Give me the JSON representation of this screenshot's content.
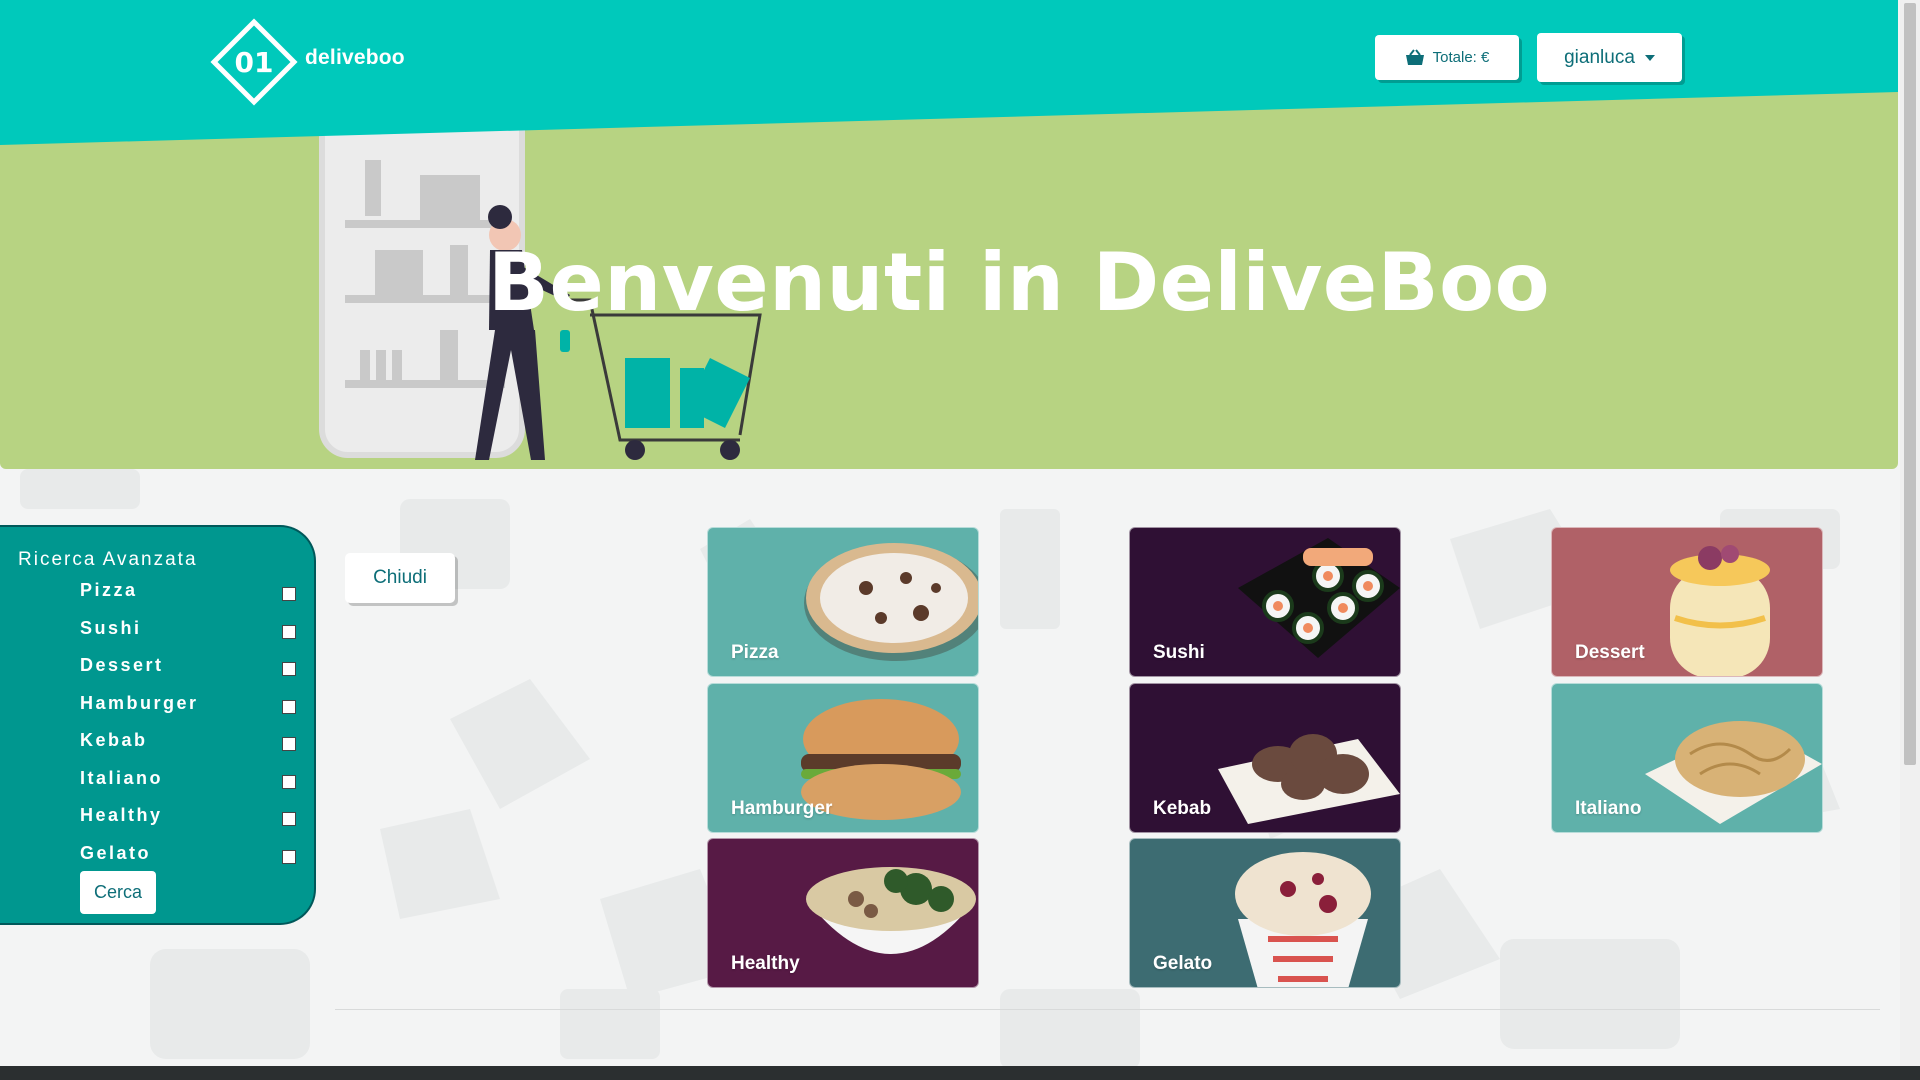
{
  "header": {
    "logo_mark": "01",
    "logo_text": "deliveboo",
    "cart_label": "Totale: €",
    "user_name": "gianluca"
  },
  "hero": {
    "title": "Benvenuti in DeliveBoo"
  },
  "sidebar": {
    "title": "Ricerca Avanzata",
    "categories": [
      "Pizza",
      "Sushi",
      "Dessert",
      "Hamburger",
      "Kebab",
      "Italiano",
      "Healthy",
      "Gelato"
    ],
    "search_label": "Cerca"
  },
  "close_label": "Chiudi",
  "cards": [
    {
      "label": "Pizza",
      "color": "#5fb1aa"
    },
    {
      "label": "Sushi",
      "color": "#2f1034"
    },
    {
      "label": "Dessert",
      "color": "#b06167"
    },
    {
      "label": "Hamburger",
      "color": "#5fb1aa"
    },
    {
      "label": "Kebab",
      "color": "#2f1034"
    },
    {
      "label": "Italiano",
      "color": "#5fb1aa"
    },
    {
      "label": "Healthy",
      "color": "#571a45"
    },
    {
      "label": "Gelato",
      "color": "#3d6c72"
    }
  ],
  "colors": {
    "header": "#00c9bb",
    "hero": "#b7d382",
    "sidebar": "#00978f",
    "accent_text": "#0d6e78"
  },
  "icons": [
    "logo-icon",
    "basket-icon",
    "chevron-down-icon"
  ]
}
